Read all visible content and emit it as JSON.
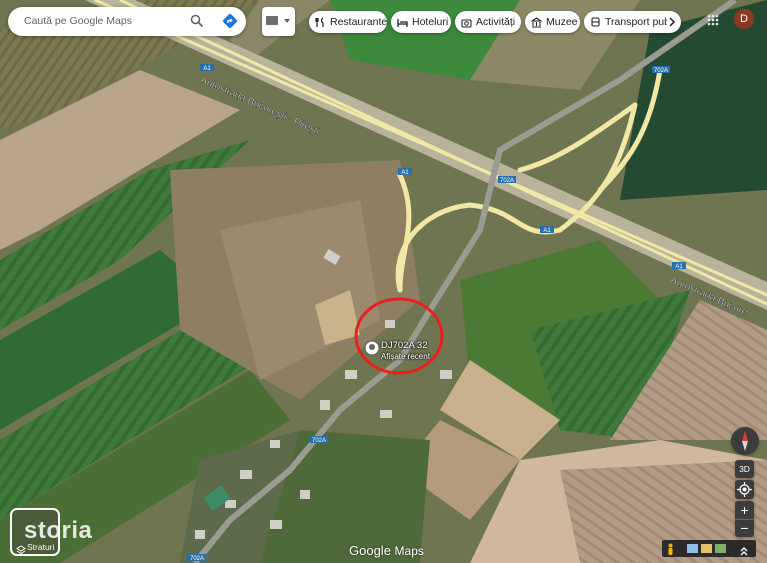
{
  "search": {
    "placeholder": "Caută pe Google Maps"
  },
  "chips": [
    {
      "label": "Restaurante",
      "icon": "fork-knife-icon"
    },
    {
      "label": "Hoteluri",
      "icon": "bed-icon"
    },
    {
      "label": "Activități",
      "icon": "camera-icon"
    },
    {
      "label": "Muzee",
      "icon": "museum-icon"
    },
    {
      "label": "Transport pub",
      "icon": "bus-icon"
    }
  ],
  "account": {
    "initial": "D",
    "color": "#8a3a22"
  },
  "map_labels": {
    "motorway_name_1": "Autostrada București - Pitești",
    "motorway_name_2": "Autostrada Bucure",
    "shield_a1": "A1",
    "shield_702a": "702A"
  },
  "pin": {
    "title": "DJ702A 32",
    "subtitle": "Afișate recent"
  },
  "watermark": {
    "google": "Google",
    "maps": "Maps",
    "storia": "storia"
  },
  "layers": {
    "label": "Straturi"
  },
  "controls": {
    "three_d": "3D",
    "zoom_in": "+",
    "zoom_out": "−"
  },
  "colors": {
    "highlight_circle": "#e8201c",
    "road": "#f2e8a6",
    "shield": "#2b6fa8"
  }
}
